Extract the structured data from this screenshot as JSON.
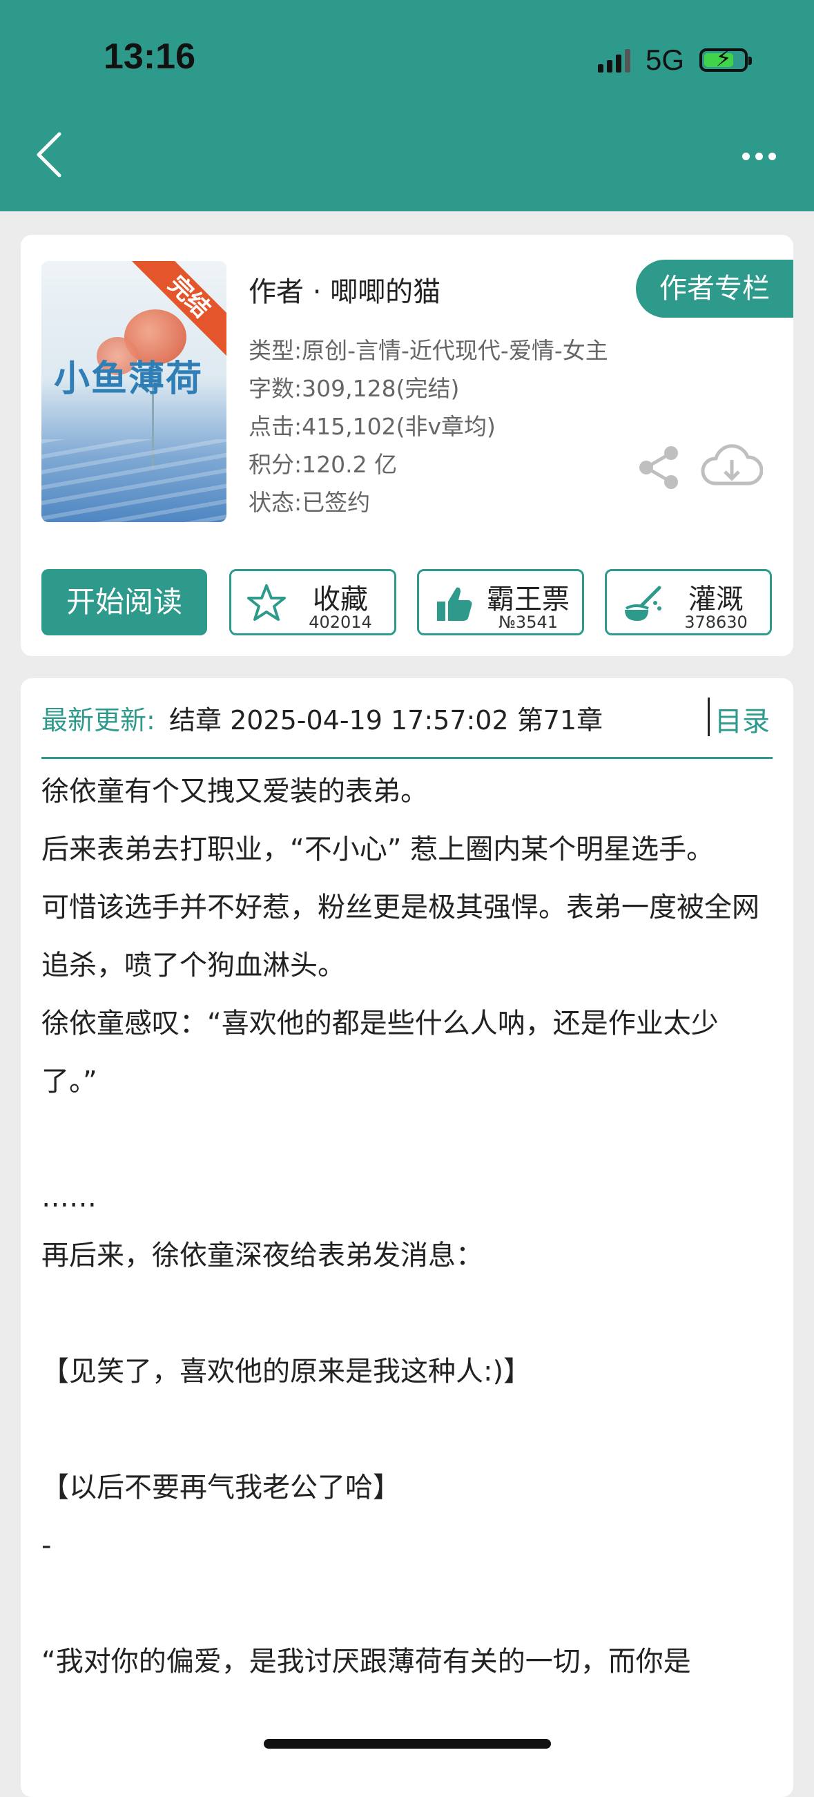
{
  "status_bar": {
    "time": "13:16",
    "network": "5G",
    "battery_level": 0.75
  },
  "nav": {
    "back_icon": "chevron-left-icon",
    "more_icon": "more-dots-icon"
  },
  "book": {
    "cover_ribbon": "完结",
    "cover_title": "小鱼薄荷",
    "author": "作者 · 唧唧的猫",
    "author_column_button": "作者专栏",
    "type": "类型:原创-言情-近代现代-爱情-女主",
    "word_count": "字数:309,128(完结)",
    "clicks": "点击:415,102(非v章均)",
    "points": "积分:120.2 亿",
    "status": "状态:已签约"
  },
  "actions": {
    "start_reading": "开始阅读",
    "collect": {
      "label": "收藏",
      "count": "402014",
      "icon": "star-icon"
    },
    "vote": {
      "label": "霸王票",
      "count": "№3541",
      "icon": "thumbs-up-icon"
    },
    "water": {
      "label": "灌溉",
      "count": "378630",
      "icon": "watering-icon"
    }
  },
  "latest_update": {
    "label": "最新更新:",
    "text": "结章 2025-04-19 17:57:02   第71章",
    "toc": "目录"
  },
  "synopsis": [
    "徐依童有个又拽又爱装的表弟。",
    "后来表弟去打职业，“不小心” 惹上圈内某个明星选手。",
    "可惜该选手并不好惹，粉丝更是极其强悍。表弟一度被全网追杀，喷了个狗血淋头。",
    "徐依童感叹：“喜欢他的都是些什么人呐，还是作业太少了。”",
    "",
    "……",
    "再后来，徐依童深夜给表弟发消息：",
    "",
    "【见笑了，喜欢他的原来是我这种人:)】",
    "",
    "【以后不要再气我老公了哈】",
    "-",
    "",
    "“我对你的偏爱，是我讨厌跟薄荷有关的一切，而你是"
  ],
  "theme": {
    "accent": "#2e9a8c",
    "ribbon": "#e4552b"
  }
}
